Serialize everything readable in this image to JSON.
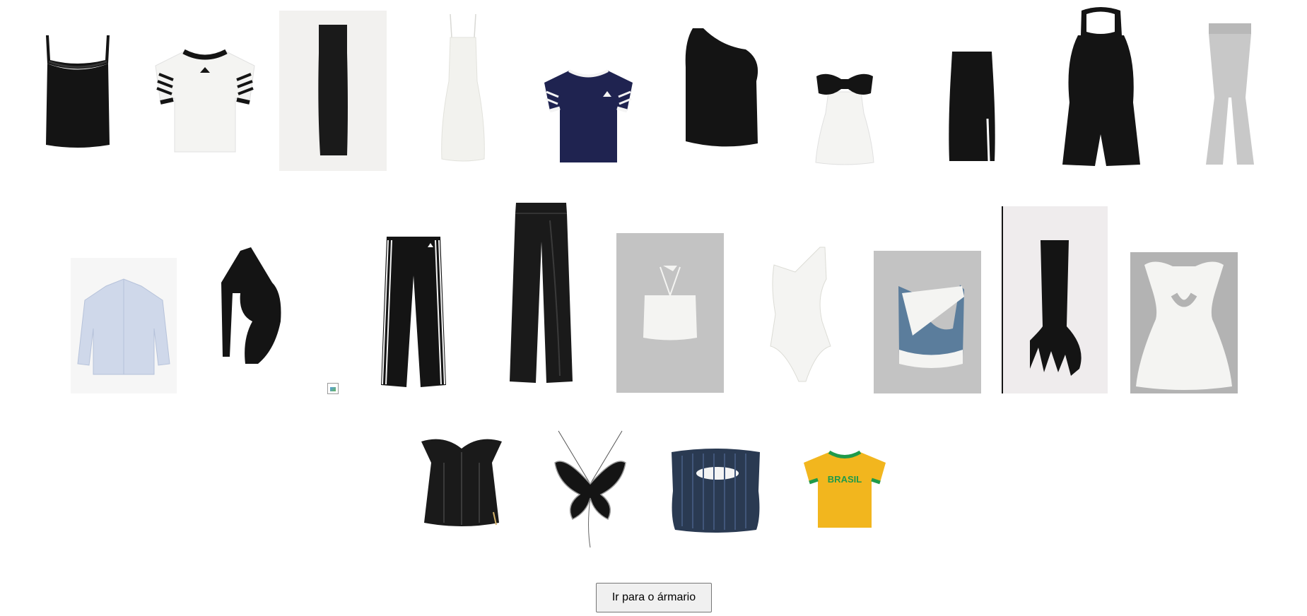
{
  "wardrobe": {
    "items": [
      {
        "name": "black lace camisole"
      },
      {
        "name": "white adidas ringer tee"
      },
      {
        "name": "black strapless maxi dress"
      },
      {
        "name": "white slip midi dress"
      },
      {
        "name": "navy adidas tee"
      },
      {
        "name": "black one-shoulder knit top"
      },
      {
        "name": "white mini dress with black bow"
      },
      {
        "name": "black midi pencil skirt"
      },
      {
        "name": "black halter romper"
      },
      {
        "name": "grey flared pants"
      },
      {
        "name": "light blue button shirt"
      },
      {
        "name": "black cut-out bodysuit"
      },
      {
        "name": "broken image"
      },
      {
        "name": "black adidas track pants"
      },
      {
        "name": "black leather wide-leg pants"
      },
      {
        "name": "white halter top"
      },
      {
        "name": "white one-shoulder swimsuit"
      },
      {
        "name": "blue and white asymmetric top"
      },
      {
        "name": "black ruffled strapless dress"
      },
      {
        "name": "white puff-sleeve cut-out dress"
      },
      {
        "name": "black leather corset"
      },
      {
        "name": "black butterfly top"
      },
      {
        "name": "navy ribbed tube top"
      },
      {
        "name": "yellow brasil baby tee"
      }
    ]
  },
  "shirt_text": {
    "brasil": "BRASIL"
  },
  "footer": {
    "button_label": "Ir para o ármario"
  },
  "colors": {
    "black": "#141414",
    "white_garment": "#f4f4f2",
    "navy": "#1f2350",
    "grey_pants": "#c8c8c8",
    "light_blue": "#cfd8ea",
    "denim_blue": "#5b7d9c",
    "yellow": "#f2b61e",
    "green": "#1f9a4a"
  }
}
